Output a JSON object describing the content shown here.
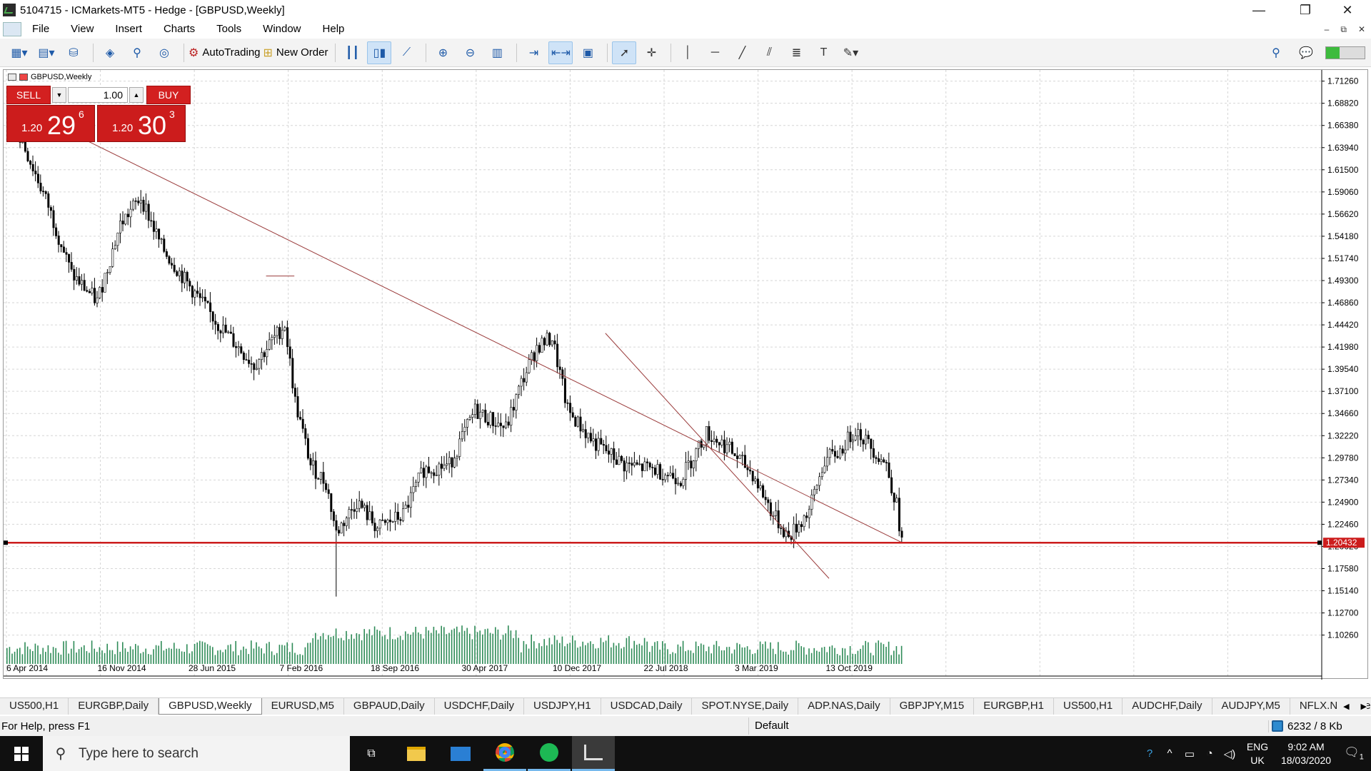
{
  "window": {
    "title": "5104715 - ICMarkets-MT5 - Hedge - [GBPUSD,Weekly]",
    "min": "—",
    "restore": "❐",
    "close": "✕"
  },
  "menu": {
    "items": [
      "File",
      "View",
      "Insert",
      "Charts",
      "Tools",
      "Window",
      "Help"
    ],
    "mdi": [
      "–",
      "⧉",
      "✕"
    ]
  },
  "toolbar": {
    "autotrading": "AutoTrading",
    "new_order": "New Order"
  },
  "chart": {
    "label": "GBPUSD,Weekly",
    "sell_label": "SELL",
    "buy_label": "BUY",
    "lot": "1.00",
    "sell_big": "1.20",
    "sell_pips": "29",
    "sell_sup": "6",
    "buy_big": "1.20",
    "buy_pips": "30",
    "buy_sup": "3",
    "colors": {
      "line": "#cc1c1c",
      "trend": "#9a3b3b",
      "volume": "#2e8b57",
      "candle": "#000000"
    }
  },
  "chart_data": {
    "type": "candlestick",
    "symbol": "GBPUSD",
    "timeframe": "Weekly",
    "x_ticks": [
      "6 Apr 2014",
      "16 Nov 2014",
      "28 Jun 2015",
      "7 Feb 2016",
      "18 Sep 2016",
      "30 Apr 2017",
      "10 Dec 2017",
      "22 Jul 2018",
      "3 Mar 2019",
      "13 Oct 2019"
    ],
    "y_ticks": [
      "1.71260",
      "1.68820",
      "1.66380",
      "1.63940",
      "1.61500",
      "1.59060",
      "1.56620",
      "1.54180",
      "1.51740",
      "1.49300",
      "1.46860",
      "1.44420",
      "1.41980",
      "1.39540",
      "1.37100",
      "1.34660",
      "1.32220",
      "1.29780",
      "1.27340",
      "1.24900",
      "1.22460",
      "1.20020",
      "1.17580",
      "1.15140",
      "1.12700",
      "1.10260"
    ],
    "ylim": [
      1.085,
      1.7249
    ],
    "current_price": "1.20432",
    "horizontal_line": 1.20432,
    "close_path": [
      {
        "week": 0,
        "price": 1.672
      },
      {
        "week": 6,
        "price": 1.645
      },
      {
        "week": 16,
        "price": 1.575
      },
      {
        "week": 25,
        "price": 1.5
      },
      {
        "week": 35,
        "price": 1.47
      },
      {
        "week": 44,
        "price": 1.555
      },
      {
        "week": 52,
        "price": 1.585
      },
      {
        "week": 60,
        "price": 1.53
      },
      {
        "week": 70,
        "price": 1.49
      },
      {
        "week": 82,
        "price": 1.445
      },
      {
        "week": 96,
        "price": 1.4
      },
      {
        "week": 108,
        "price": 1.445
      },
      {
        "week": 112,
        "price": 1.36
      },
      {
        "week": 118,
        "price": 1.29
      },
      {
        "week": 124,
        "price": 1.27
      },
      {
        "week": 128,
        "price": 1.215
      },
      {
        "week": 136,
        "price": 1.25
      },
      {
        "week": 144,
        "price": 1.22
      },
      {
        "week": 154,
        "price": 1.235
      },
      {
        "week": 162,
        "price": 1.285
      },
      {
        "week": 172,
        "price": 1.29
      },
      {
        "week": 182,
        "price": 1.35
      },
      {
        "week": 194,
        "price": 1.33
      },
      {
        "week": 200,
        "price": 1.38
      },
      {
        "week": 206,
        "price": 1.42
      },
      {
        "week": 212,
        "price": 1.43
      },
      {
        "week": 218,
        "price": 1.35
      },
      {
        "week": 228,
        "price": 1.315
      },
      {
        "week": 240,
        "price": 1.29
      },
      {
        "week": 252,
        "price": 1.285
      },
      {
        "week": 262,
        "price": 1.275
      },
      {
        "week": 272,
        "price": 1.325
      },
      {
        "week": 280,
        "price": 1.31
      },
      {
        "week": 290,
        "price": 1.28
      },
      {
        "week": 298,
        "price": 1.235
      },
      {
        "week": 304,
        "price": 1.21
      },
      {
        "week": 312,
        "price": 1.24
      },
      {
        "week": 318,
        "price": 1.295
      },
      {
        "week": 324,
        "price": 1.305
      },
      {
        "week": 330,
        "price": 1.33
      },
      {
        "week": 336,
        "price": 1.31
      },
      {
        "week": 342,
        "price": 1.29
      },
      {
        "week": 346,
        "price": 1.245
      },
      {
        "week": 348,
        "price": 1.205
      }
    ],
    "trendlines": [
      {
        "from": {
          "week": 22,
          "price": 1.66
        },
        "to": {
          "week": 348,
          "price": 1.205
        }
      },
      {
        "from": {
          "week": 101,
          "price": 1.498
        },
        "to": {
          "week": 112,
          "price": 1.498
        }
      },
      {
        "from": {
          "week": 233,
          "price": 1.435
        },
        "to": {
          "week": 320,
          "price": 1.165
        }
      }
    ]
  },
  "tabs": [
    "US500,H1",
    "EURGBP,Daily",
    "GBPUSD,Weekly",
    "EURUSD,M5",
    "GBPAUD,Daily",
    "USDCHF,Daily",
    "USDJPY,H1",
    "USDCAD,Daily",
    "SPOT.NYSE,Daily",
    "ADP.NAS,Daily",
    "GBPJPY,M15",
    "EURGBP,H1",
    "US500,H1",
    "AUDCHF,Daily",
    "AUDJPY,M5",
    "NFLX.NAS,Weekl"
  ],
  "status": {
    "help": "For Help, press F1",
    "profile": "Default",
    "traffic": "6232 / 8 Kb"
  },
  "taskbar": {
    "search_placeholder": "Type here to search",
    "lang1": "ENG",
    "lang2": "UK",
    "time": "9:02 AM",
    "date": "18/03/2020",
    "notif_count": "1"
  }
}
